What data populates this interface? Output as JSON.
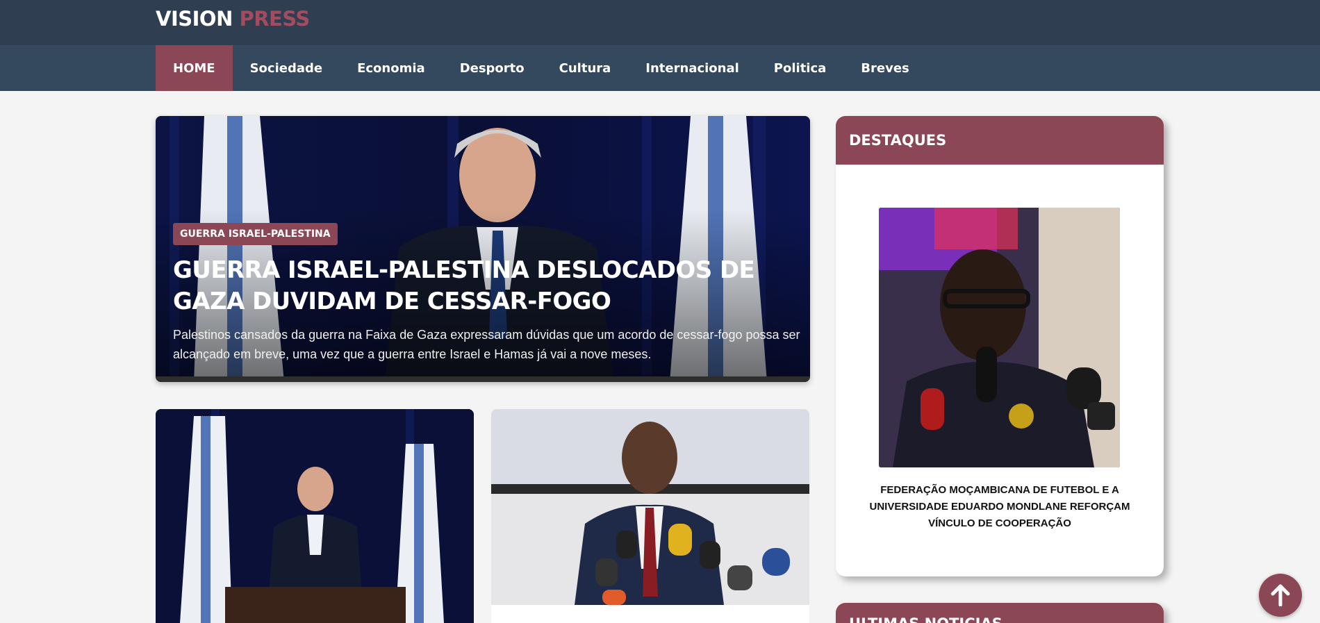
{
  "brand": {
    "name_main": "VISION",
    "name_accent": "PRESS"
  },
  "nav": {
    "items": [
      {
        "label": "HOME",
        "active": true
      },
      {
        "label": "Sociedade"
      },
      {
        "label": "Economia"
      },
      {
        "label": "Desporto"
      },
      {
        "label": "Cultura"
      },
      {
        "label": "Internacional"
      },
      {
        "label": "Politica"
      },
      {
        "label": "Breves"
      }
    ]
  },
  "hero": {
    "tag": "GUERRA ISRAEL-PALESTINA",
    "title": "GUERRA ISRAEL-PALESTINA DESLOCADOS DE GAZA DUVIDAM DE CESSAR-FOGO",
    "excerpt": "Palestinos cansados da guerra na Faixa de Gaza expressaram dúvidas que um acordo de cessar-fogo possa ser alcançado em breve, uma vez que a guerra entre Israel e Hamas já vai a nove meses."
  },
  "sidebar": {
    "heading": "DESTAQUES",
    "featured_caption": "FEDERAÇÃO MOÇAMBICANA DE FUTEBOL E A UNIVERSIDADE EDUARDO MONDLANE REFORÇAM VÍNCULO DE COOPERAÇÃO",
    "second_heading": "ULTIMAS NOTICIAS"
  },
  "colors": {
    "topbar": "#2f3e50",
    "navbar": "#34495e",
    "accent": "#8b4756",
    "page_bg": "#f4f4f4"
  },
  "icons": {
    "back_to_top": "arrow-up-icon"
  }
}
